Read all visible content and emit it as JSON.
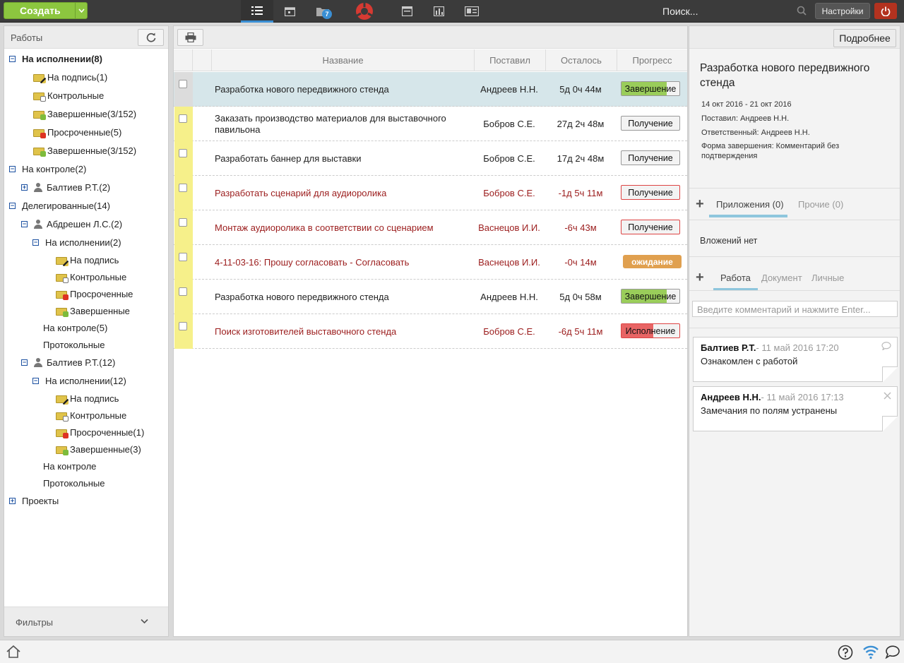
{
  "topbar": {
    "create_label": "Создать",
    "badge": "7",
    "search_placeholder": "Поиск...",
    "settings_label": "Настройки"
  },
  "left": {
    "title": "Работы",
    "filters_label": "Фильтры",
    "tree": [
      {
        "label": "На исполнении(8)",
        "bold": true
      },
      {
        "label": "На подпись(1)"
      },
      {
        "label": "Контрольные"
      },
      {
        "label": "Завершенные(3/152)"
      },
      {
        "label": "Просроченные(5)"
      },
      {
        "label": "Завершенные(3/152)"
      },
      {
        "label": "На контроле(2)"
      },
      {
        "label": "Балтиев Р.Т.(2)"
      },
      {
        "label": "Делегированные(14)"
      },
      {
        "label": "Абдрешен Л.С.(2)"
      },
      {
        "label": "На исполнении(2)"
      },
      {
        "label": "На подпись"
      },
      {
        "label": "Контрольные"
      },
      {
        "label": "Просроченные"
      },
      {
        "label": "Завершенные"
      },
      {
        "label": "На контроле(5)"
      },
      {
        "label": "Протокольные"
      },
      {
        "label": "Балтиев Р.Т.(12)"
      },
      {
        "label": "На исполнении(12)"
      },
      {
        "label": "На подпись"
      },
      {
        "label": "Контрольные"
      },
      {
        "label": "Просроченные(1)"
      },
      {
        "label": "Завершенные(3)"
      },
      {
        "label": "На контроле"
      },
      {
        "label": "Протокольные"
      },
      {
        "label": "Проекты"
      }
    ]
  },
  "table": {
    "headers": {
      "name": "Название",
      "who": "Поставил",
      "left": "Осталось",
      "progress": "Прогресс"
    },
    "rows": [
      {
        "name": "Разработка нового передвижного стенда",
        "who": "Андреев Н.Н.",
        "left": "5д 0ч 44м",
        "progress": "Завершение",
        "fill": 0.78,
        "red": false
      },
      {
        "name": "Заказать производство материалов для выставочного павильона",
        "who": "Бобров С.Е.",
        "left": "27д 2ч 48м",
        "progress": "Получение",
        "fill": 0,
        "red": false
      },
      {
        "name": "Разработать баннер для выставки",
        "who": "Бобров С.Е.",
        "left": "17д 2ч 48м",
        "progress": "Получение",
        "fill": 0,
        "red": false
      },
      {
        "name": "Разработать сценарий для аудиоролика",
        "who": "Бобров С.Е.",
        "left": "-1д 5ч 11м",
        "progress": "Получение",
        "fill": 0,
        "red": true
      },
      {
        "name": "Монтаж аудиоролика в соответствии со сценарием",
        "who": "Васнецов И.И.",
        "left": "-6ч 43м",
        "progress": "Получение",
        "fill": 0,
        "red": true
      },
      {
        "name": "4-11-03-16: Прошу согласовать - Согласовать",
        "who": "Васнецов И.И.",
        "left": "-0ч 14м",
        "progress": "ожидание",
        "fill": 0,
        "red": true
      },
      {
        "name": "Разработка нового передвижного стенда",
        "who": "Андреев Н.Н.",
        "left": "5д 0ч 58м",
        "progress": "Завершение",
        "fill": 0.78,
        "red": false
      },
      {
        "name": "Поиск изготовителей выставочного стенда",
        "who": "Бобров С.Е.",
        "left": "-6д 5ч 11м",
        "progress": "Исполнение",
        "fill": 0.55,
        "red": true
      }
    ]
  },
  "detail": {
    "more_label": "Подробнее",
    "title": "Разработка нового передвижного стенда",
    "dates": "14 окт 2016 - 21 окт 2016",
    "assigned": "Поставил: Андреев Н.Н.",
    "responsible": "Ответственный: Андреев Н.Н.",
    "completion": "Форма завершения: Комментарий без подтверждения",
    "tabs1": [
      "Приложения (0)",
      "Прочие (0)"
    ],
    "no_attachments": "Вложений нет",
    "tabs2": [
      "Работа",
      "Документ",
      "Личные"
    ],
    "comment_placeholder": "Введите комментарий и нажмите Enter...",
    "comments": [
      {
        "author": "Балтиев Р.Т.",
        "date": "- 11 май 2016 17:20",
        "text": "Ознакомлен с работой"
      },
      {
        "author": "Андреев Н.Н.",
        "date": "- 11 май 2016 17:13",
        "text": "Замечания по полям устранены"
      }
    ]
  },
  "colors": {
    "accent": "#3a8fd4",
    "create": "#8cc63f",
    "power": "#b3321f",
    "overdue": "#9b1c1c"
  }
}
